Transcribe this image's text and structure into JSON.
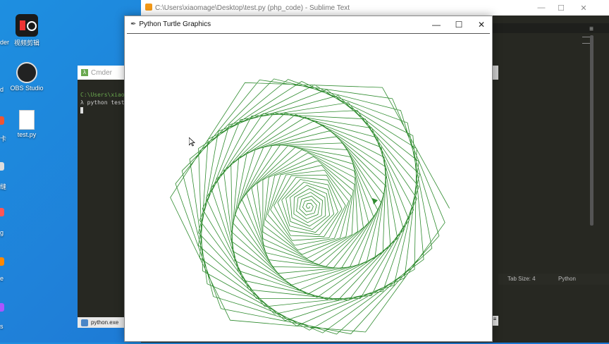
{
  "desktop": {
    "icons": [
      {
        "label": "视频剪辑",
        "icon": "app-icon"
      },
      {
        "label": "OBS Studio",
        "icon": "obs-icon"
      },
      {
        "label": "test.py",
        "icon": "file-icon"
      }
    ],
    "edge_labels": [
      "der",
      "d",
      "卡",
      "缝",
      "g",
      "e",
      "s"
    ]
  },
  "sublime": {
    "title": "C:\\Users\\xiaomage\\Desktop\\test.py (php_code) - Sublime Text",
    "status_tab_size": "Tab Size: 4",
    "status_syntax": "Python"
  },
  "cmder": {
    "title": "Cmder",
    "path_line": "C:\\Users\\xiao",
    "command_line": "λ python test",
    "taskbar_label": "python.exe"
  },
  "turtle": {
    "title": "Python Turtle Graphics",
    "pen_color": "#2e8b2e"
  },
  "window_controls": {
    "minimize": "—",
    "maximize": "☐",
    "close": "✕"
  }
}
